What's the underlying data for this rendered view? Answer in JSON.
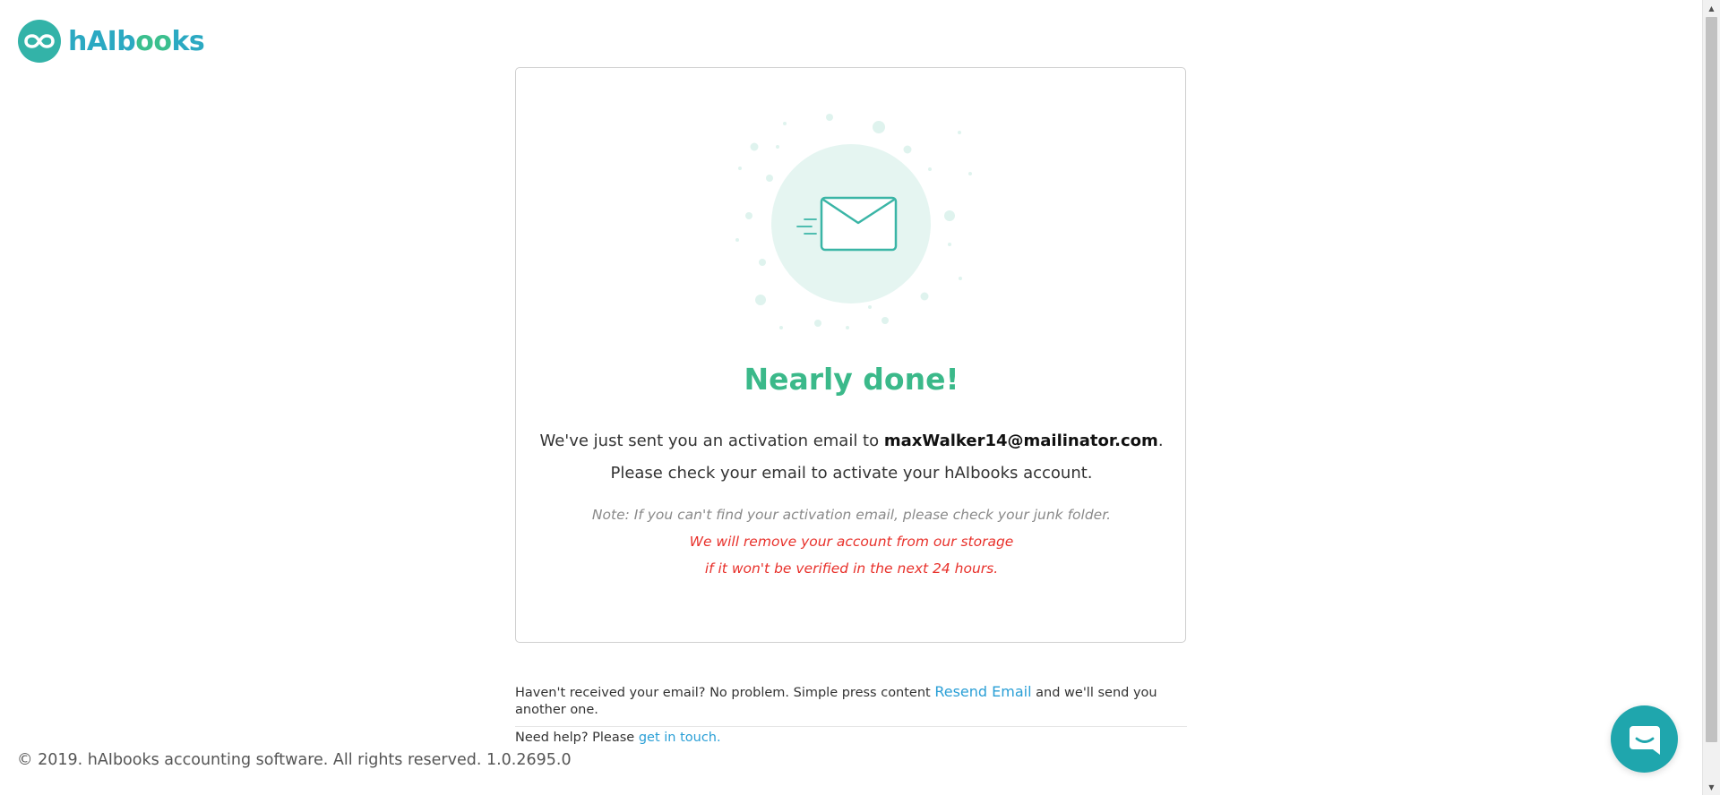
{
  "brand": {
    "name_prefix": "hAIb",
    "name_oo": "oo",
    "name_suffix": "ks",
    "logo_icon": "infinity-icon"
  },
  "card": {
    "illustration_icon": "envelope-icon",
    "title": "Nearly done!",
    "message_prefix": "We've just sent you an activation email to ",
    "email": "maxWalker14@mailinator.com",
    "message_suffix": ".",
    "message_line2": "Please check your email to activate your hAIbooks account.",
    "note": "Note: If you can't find your activation email, please check your junk folder.",
    "warning_line1": "We will remove your account from our storage",
    "warning_line2": "if it won't be verified in the next 24 hours."
  },
  "resend": {
    "text_before": "Haven't received your email? No problem. Simple press content ",
    "link": "Resend Email",
    "text_after": " and we'll send you another one."
  },
  "help": {
    "text": "Need help? Please ",
    "link": "get in touch."
  },
  "footer": {
    "copyright": "© 2019. hAIbooks accounting software. All rights reserved. 1.0.2695.0"
  },
  "chat": {
    "icon": "chat-bubble-icon"
  },
  "colors": {
    "brand_teal": "#33b3a8",
    "title_green": "#3bb98a",
    "link_blue": "#2a9fd6",
    "warning_red": "#e8312b",
    "chat_teal": "#1fa6ad"
  }
}
